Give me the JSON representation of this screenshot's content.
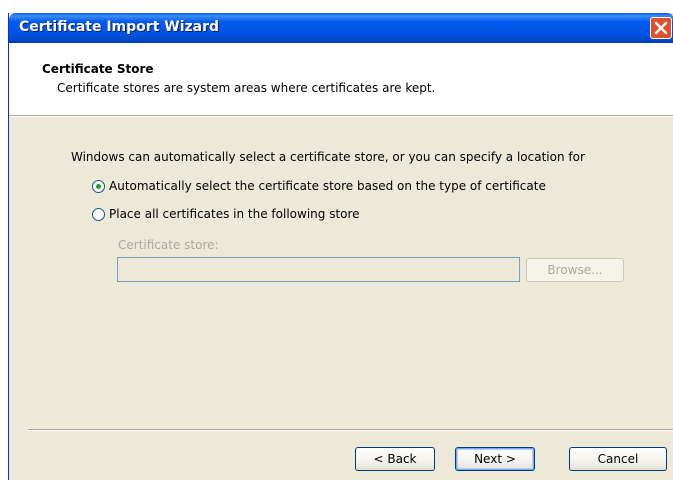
{
  "window": {
    "title": "Certificate Import Wizard"
  },
  "header": {
    "title": "Certificate Store",
    "subtitle": "Certificate stores are system areas where certificates are kept."
  },
  "body": {
    "intro": "Windows can automatically select a certificate store, or you can specify a location for",
    "options": [
      {
        "label": "Automatically select the certificate store based on the type of certificate",
        "selected": true
      },
      {
        "label": "Place all certificates in the following store",
        "selected": false
      }
    ],
    "store_label": "Certificate store:",
    "store_value": "",
    "browse_label": "Browse..."
  },
  "buttons": {
    "back": "< Back",
    "next": "Next >",
    "cancel": "Cancel"
  },
  "colors": {
    "titlebar": "#0054e3",
    "dialog_bg": "#ece9d8",
    "radio_dot": "#21a121",
    "close_button": "#e0502b"
  },
  "icons": {
    "close": "close-icon"
  }
}
